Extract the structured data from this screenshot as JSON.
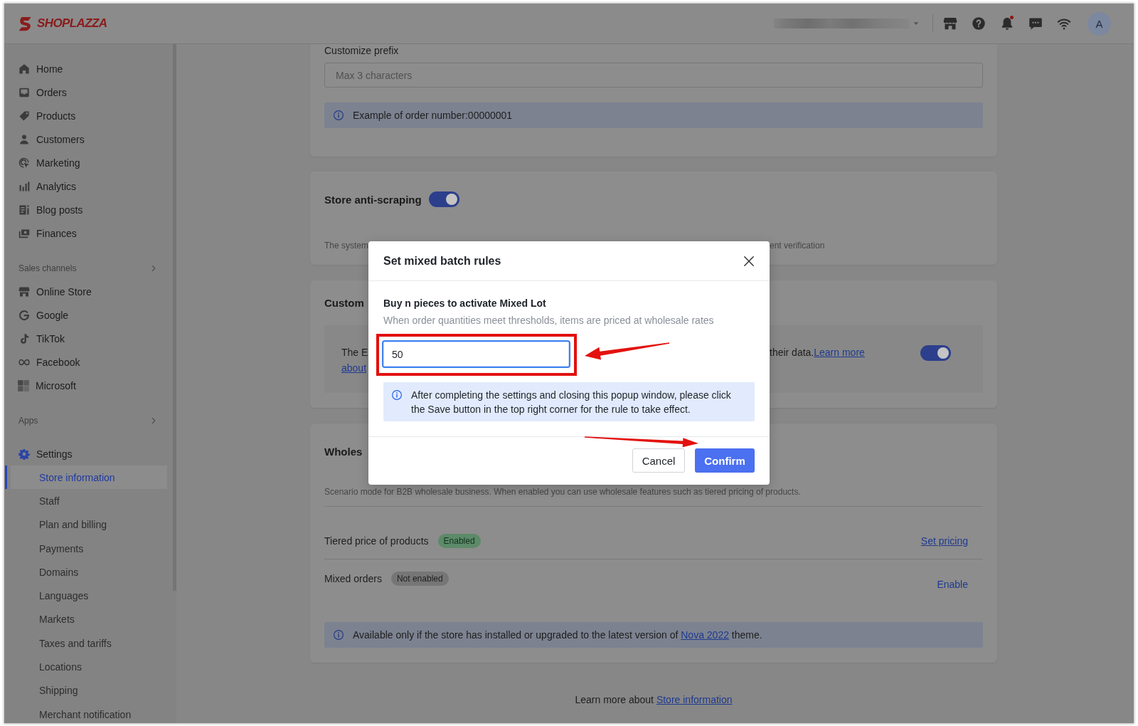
{
  "topbar": {
    "logo": "SHOPLAZZA",
    "unread": true,
    "avatar": "A"
  },
  "sidebar": {
    "main": [
      {
        "label": "Home",
        "selected": false
      },
      {
        "label": "Orders",
        "selected": false
      },
      {
        "label": "Products",
        "selected": false
      },
      {
        "label": "Customers",
        "selected": false
      },
      {
        "label": "Marketing",
        "selected": false
      },
      {
        "label": "Analytics",
        "selected": false
      },
      {
        "label": "Blog posts",
        "selected": false
      },
      {
        "label": "Finances",
        "selected": false
      }
    ],
    "sales_channels": {
      "title": "Sales channels",
      "items": [
        {
          "label": "Online Store",
          "selected": false
        },
        {
          "label": "Google",
          "selected": false
        },
        {
          "label": "TikTok",
          "selected": false
        },
        {
          "label": "Facebook",
          "selected": false
        },
        {
          "label": "Microsoft",
          "selected": false
        }
      ]
    },
    "apps": {
      "title": "Apps"
    },
    "settings": {
      "label": "Settings",
      "expanded": true,
      "children": [
        {
          "label": "Store information",
          "selected": true
        },
        {
          "label": "Staff",
          "selected": false
        },
        {
          "label": "Plan and billing",
          "selected": false
        },
        {
          "label": "Payments",
          "selected": false
        },
        {
          "label": "Domains",
          "selected": false
        },
        {
          "label": "Languages",
          "selected": false
        },
        {
          "label": "Markets",
          "selected": false
        },
        {
          "label": "Taxes and tariffs",
          "selected": false
        },
        {
          "label": "Locations",
          "selected": false
        },
        {
          "label": "Shipping",
          "selected": false
        },
        {
          "label": "Merchant notification",
          "selected": false
        }
      ]
    }
  },
  "prefix_card": {
    "label": "Customize prefix",
    "placeholder": "Max 3 characters",
    "info": "Example of order number:00000001"
  },
  "anti_scraping_card": {
    "title": "Store anti-scraping",
    "on": true,
    "description_start": "The system",
    "description_end": "ent verification"
  },
  "customer_card": {
    "title": "Custom",
    "on": true,
    "notice_start": "The E",
    "notice_end": "their data.",
    "link": "Learn more",
    "link_continued": "about"
  },
  "wholesale_card": {
    "title": "Wholes",
    "description": "Scenario mode for B2B wholesale business. When enabled you can use wholesale features such as tiered pricing of products.",
    "rows": [
      {
        "label": "Tiered price of products",
        "status": "Enabled",
        "enabled": true,
        "action": "Set pricing",
        "kind": "link"
      },
      {
        "label": "Mixed orders",
        "status": "Not enabled",
        "enabled": false,
        "action": "Enable",
        "kind": "button"
      }
    ],
    "info_before": "Available only if the store has installed or upgraded to the latest version of",
    "info_link": "Nova 2022",
    "info_after": "theme."
  },
  "footer": {
    "text": "Learn more about",
    "link": "Store information"
  },
  "modal": {
    "title": "Set mixed batch rules",
    "field_label": "Buy n pieces to activate Mixed Lot",
    "field_hint": "When order quantities meet thresholds, items are priced at wholesale rates",
    "value": "50",
    "focused": true,
    "info": "After completing the settings and closing this popup window, please click the Save button in the top right corner for the rule to take effect.",
    "buttons": [
      {
        "label": "Cancel",
        "kind": "secondary"
      },
      {
        "label": "Confirm",
        "kind": "primary"
      }
    ]
  },
  "annotations": [
    {
      "kind": "box"
    },
    {
      "kind": "arrow"
    },
    {
      "kind": "arrow"
    }
  ]
}
